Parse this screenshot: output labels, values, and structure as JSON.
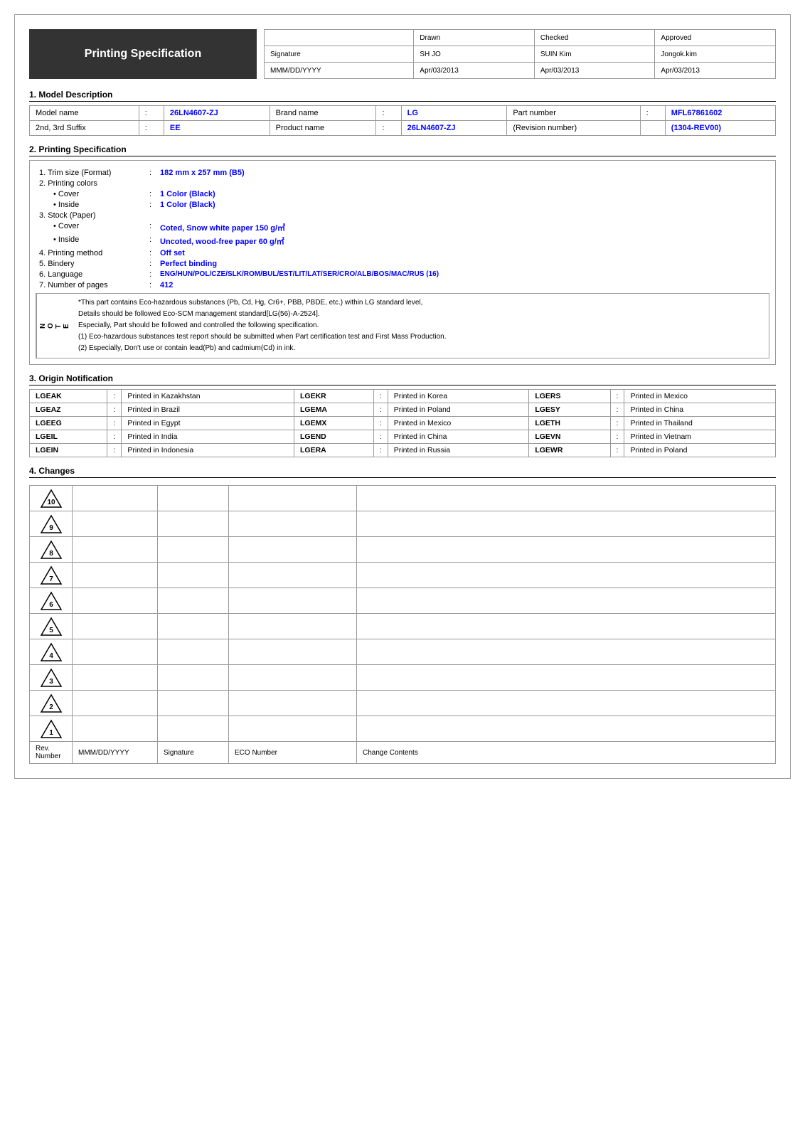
{
  "header": {
    "title": "Printing Specification",
    "approval": {
      "columns": [
        "",
        "Drawn",
        "Checked",
        "Approved"
      ],
      "rows": [
        [
          "Signature",
          "SH JO",
          "SUIN Kim",
          "Jongok.kim"
        ],
        [
          "MMM/DD/YYYY",
          "Apr/03/2013",
          "Apr/03/2013",
          "Apr/03/2013"
        ]
      ]
    }
  },
  "section1": {
    "title": "1. Model Description",
    "rows": [
      {
        "fields": [
          {
            "label": "Model name",
            "colon": ":",
            "value": "26LN4607-ZJ"
          },
          {
            "label": "Brand name",
            "colon": ":",
            "value": "LG"
          },
          {
            "label": "Part number",
            "colon": ":",
            "value": "MFL67861602"
          }
        ]
      },
      {
        "fields": [
          {
            "label": "2nd, 3rd Suffix",
            "colon": ":",
            "value": "EE"
          },
          {
            "label": "Product name",
            "colon": ":",
            "value": "26LN4607-ZJ"
          },
          {
            "label": "(Revision number)",
            "colon": "",
            "value": "(1304-REV00)"
          }
        ]
      }
    ]
  },
  "section2": {
    "title": "2. Printing Specification",
    "items": [
      {
        "indent": 0,
        "label": "1. Trim size (Format)",
        "colon": ":",
        "value": "182 mm x 257 mm (B5)",
        "colored": true
      },
      {
        "indent": 0,
        "label": "2. Printing colors",
        "colon": "",
        "value": "",
        "colored": false
      },
      {
        "indent": 1,
        "label": "• Cover",
        "colon": ":",
        "value": "1 Color (Black)",
        "colored": true
      },
      {
        "indent": 1,
        "label": "• Inside",
        "colon": ":",
        "value": "1 Color (Black)",
        "colored": true
      },
      {
        "indent": 0,
        "label": "3. Stock (Paper)",
        "colon": "",
        "value": "",
        "colored": false
      },
      {
        "indent": 1,
        "label": "• Cover",
        "colon": ":",
        "value": "Coted, Snow white paper 150 g/㎡",
        "colored": true
      },
      {
        "indent": 1,
        "label": "• Inside",
        "colon": ":",
        "value": "Uncoted, wood-free paper 60 g/㎡",
        "colored": true
      },
      {
        "indent": 0,
        "label": "4. Printing method",
        "colon": ":",
        "value": "Off set",
        "colored": true
      },
      {
        "indent": 0,
        "label": "5. Bindery",
        "colon": ":",
        "value": "Perfect binding",
        "colored": true
      },
      {
        "indent": 0,
        "label": "6. Language",
        "colon": ":",
        "value": "ENG/HUN/POL/CZE/SLK/ROM/BUL/EST/LIT/LAT/SER/CRO/ALB/BOS/MAC/RUS (16)",
        "colored": true,
        "lang": true
      },
      {
        "indent": 0,
        "label": "7. Number of pages",
        "colon": ":",
        "value": "412",
        "colored": true
      }
    ],
    "notes": [
      "*This part contains Eco-hazardous substances (Pb, Cd, Hg, Cr6+, PBB, PBDE, etc.) within LG standard level,",
      "Details should be followed Eco-SCM management standard[LG(56)-A-2524].",
      "Especially, Part should be followed and controlled the following specification.",
      "(1) Eco-hazardous substances test report should be submitted when Part certification test and First Mass Production.",
      "(2) Especially, Don't use or contain lead(Pb) and cadmium(Cd) in ink."
    ]
  },
  "section3": {
    "title": "3. Origin Notification",
    "rows": [
      [
        {
          "code": "LGEAK",
          "colon": ":",
          "desc": "Printed in Kazakhstan"
        },
        {
          "code": "LGEKR",
          "colon": ":",
          "desc": "Printed in Korea"
        },
        {
          "code": "LGERS",
          "colon": ":",
          "desc": "Printed in Mexico"
        }
      ],
      [
        {
          "code": "LGEAZ",
          "colon": ":",
          "desc": "Printed in Brazil"
        },
        {
          "code": "LGEMA",
          "colon": ":",
          "desc": "Printed in Poland"
        },
        {
          "code": "LGESY",
          "colon": ":",
          "desc": "Printed in China"
        }
      ],
      [
        {
          "code": "LGEEG",
          "colon": ":",
          "desc": "Printed in Egypt"
        },
        {
          "code": "LGEMX",
          "colon": ":",
          "desc": "Printed in Mexico"
        },
        {
          "code": "LGETH",
          "colon": ":",
          "desc": "Printed in Thailand"
        }
      ],
      [
        {
          "code": "LGEIL",
          "colon": ":",
          "desc": "Printed in India"
        },
        {
          "code": "LGEND",
          "colon": ":",
          "desc": "Printed in China"
        },
        {
          "code": "LGEVN",
          "colon": ":",
          "desc": "Printed in Vietnam"
        }
      ],
      [
        {
          "code": "LGEIN",
          "colon": ":",
          "desc": "Printed in Indonesia"
        },
        {
          "code": "LGERA",
          "colon": ":",
          "desc": "Printed in Russia"
        },
        {
          "code": "LGEWR",
          "colon": ":",
          "desc": "Printed in Poland"
        }
      ]
    ]
  },
  "section4": {
    "title": "4. Changes",
    "rev_numbers": [
      10,
      9,
      8,
      7,
      6,
      5,
      4,
      3,
      2,
      1
    ],
    "footer": {
      "cols": [
        "Rev. Number",
        "MMM/DD/YYYY",
        "Signature",
        "ECO Number",
        "Change Contents"
      ]
    }
  }
}
